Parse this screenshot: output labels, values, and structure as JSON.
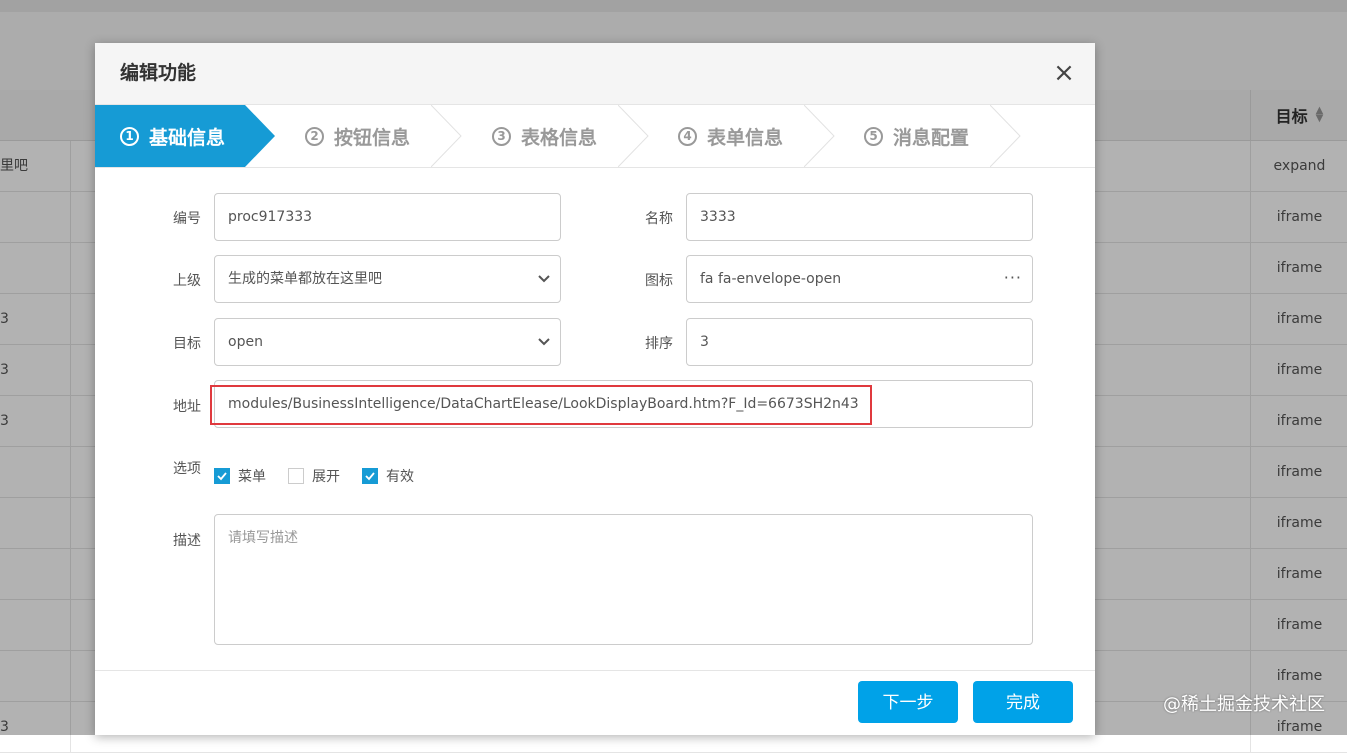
{
  "background": {
    "column_header_target": "目标",
    "rows": [
      {
        "left": "里吧",
        "target": "expand"
      },
      {
        "left": "",
        "target": "iframe"
      },
      {
        "left": "",
        "target": "iframe"
      },
      {
        "left": "3",
        "target": "iframe"
      },
      {
        "left": "3",
        "target": "iframe"
      },
      {
        "left": "3",
        "target": "iframe"
      },
      {
        "left": "",
        "target": "iframe"
      },
      {
        "left": "",
        "target": "iframe"
      },
      {
        "left": "",
        "target": "iframe"
      },
      {
        "left": "",
        "target": "iframe"
      },
      {
        "left": "",
        "target": "iframe"
      },
      {
        "left": "3",
        "target": "iframe"
      }
    ]
  },
  "dialog": {
    "title": "编辑功能",
    "close_icon": "×",
    "steps": [
      {
        "num": "1",
        "label": "基础信息",
        "active": true
      },
      {
        "num": "2",
        "label": "按钮信息",
        "active": false
      },
      {
        "num": "3",
        "label": "表格信息",
        "active": false
      },
      {
        "num": "4",
        "label": "表单信息",
        "active": false
      },
      {
        "num": "5",
        "label": "消息配置",
        "active": false
      }
    ],
    "form": {
      "code_label": "编号",
      "code_value": "proc917333",
      "name_label": "名称",
      "name_value": "3333",
      "parent_label": "上级",
      "parent_value": "生成的菜单都放在这里吧",
      "icon_label": "图标",
      "icon_value": "fa fa-envelope-open",
      "icon_picker": "···",
      "target_label": "目标",
      "target_value": "open",
      "sort_label": "排序",
      "sort_value": "3",
      "url_label": "地址",
      "url_value": "modules/BusinessIntelligence/DataChartElease/LookDisplayBoard.htm?F_Id=6673SH2n43",
      "options_label": "选项",
      "options": [
        {
          "label": "菜单",
          "checked": true
        },
        {
          "label": "展开",
          "checked": false
        },
        {
          "label": "有效",
          "checked": true
        }
      ],
      "desc_label": "描述",
      "desc_placeholder": "请填写描述"
    },
    "buttons": {
      "next": "下一步",
      "finish": "完成"
    },
    "accent_color": "#169bd5",
    "highlight_color": "#e0393e"
  },
  "watermark": "@稀土掘金技术社区"
}
